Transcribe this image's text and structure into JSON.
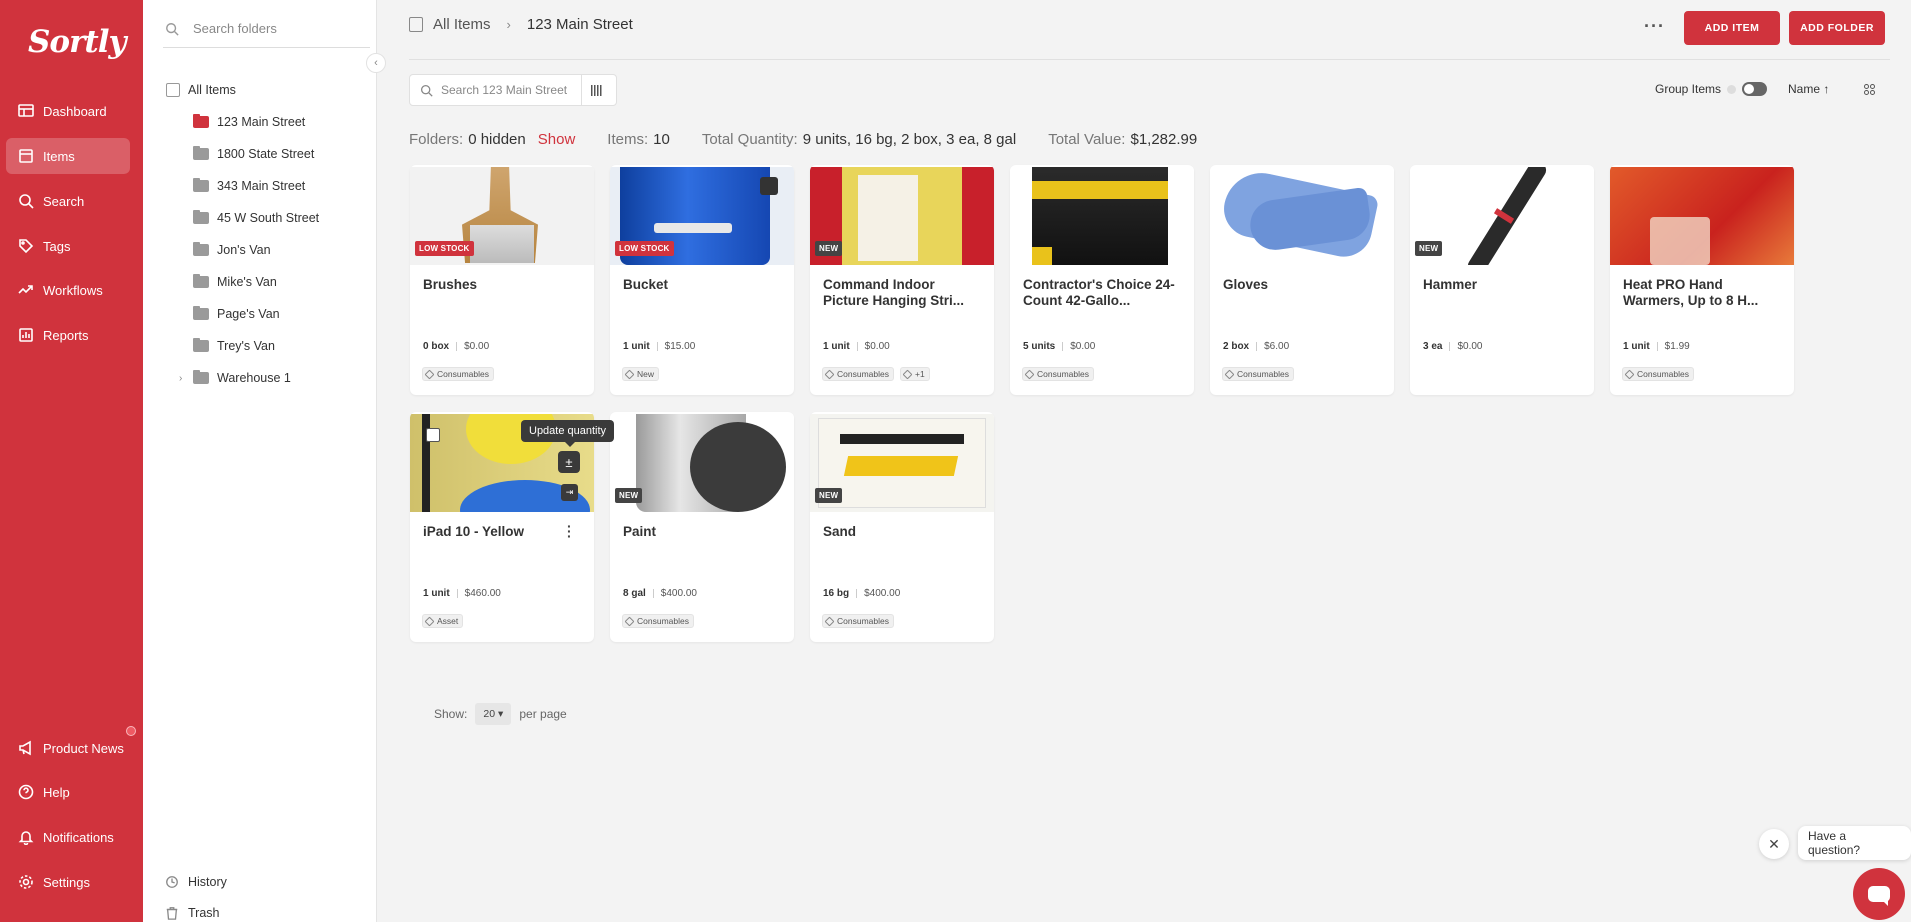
{
  "app": {
    "logo": "Sortly",
    "brand_color": "#d0333d"
  },
  "nav": {
    "items": [
      {
        "label": "Dashboard",
        "icon": "dashboard-icon"
      },
      {
        "label": "Items",
        "icon": "items-icon",
        "active": true
      },
      {
        "label": "Search",
        "icon": "search-icon"
      },
      {
        "label": "Tags",
        "icon": "tag-icon"
      },
      {
        "label": "Workflows",
        "icon": "workflow-icon"
      },
      {
        "label": "Reports",
        "icon": "reports-icon"
      }
    ],
    "bottom": [
      {
        "label": "Product News",
        "icon": "megaphone-icon"
      },
      {
        "label": "Help",
        "icon": "help-icon"
      },
      {
        "label": "Notifications",
        "icon": "bell-icon"
      },
      {
        "label": "Settings",
        "icon": "gear-icon"
      }
    ]
  },
  "folders": {
    "search_placeholder": "Search folders",
    "all_items": "All Items",
    "list": [
      "123 Main Street",
      "1800 State Street",
      "343 Main Street",
      "45 W South Street",
      "Jon's Van",
      "Mike's Van",
      "Page's Van",
      "Trey's Van",
      "Warehouse 1"
    ],
    "history": "History",
    "trash": "Trash"
  },
  "header": {
    "crumb_root": "All Items",
    "crumb_current": "123 Main Street",
    "add_item": "ADD ITEM",
    "add_folder": "ADD FOLDER"
  },
  "toolbar": {
    "search_placeholder": "Search 123 Main Street",
    "group_items": "Group Items",
    "sort_label": "Name"
  },
  "summary": {
    "folders_label": "Folders:",
    "folders_value": "0 hidden",
    "show": "Show",
    "items_label": "Items:",
    "items_value": "10",
    "qty_label": "Total Quantity:",
    "qty_value": "9 units, 16 bg, 2 box, 3 ea, 8 gal",
    "value_label": "Total Value:",
    "value_value": "$1,282.99"
  },
  "cards": [
    {
      "name": "Brushes",
      "chip": "LOW STOCK",
      "qty": "0 box",
      "price": "$0.00",
      "tags": [
        "Consumables"
      ]
    },
    {
      "name": "Bucket",
      "chip": "LOW STOCK",
      "qty": "1 unit",
      "price": "$15.00",
      "tags": [
        "New"
      ]
    },
    {
      "name": "Command Indoor Picture Hanging Stri...",
      "chip": "NEW",
      "qty": "1 unit",
      "price": "$0.00",
      "tags": [
        "Consumables",
        "+1"
      ]
    },
    {
      "name": "Contractor's Choice 24-Count 42-Gallo...",
      "chip": "",
      "qty": "5 units",
      "price": "$0.00",
      "tags": [
        "Consumables"
      ]
    },
    {
      "name": "Gloves",
      "chip": "",
      "qty": "2 box",
      "price": "$6.00",
      "tags": [
        "Consumables"
      ]
    },
    {
      "name": "Hammer",
      "chip": "NEW",
      "qty": "3 ea",
      "price": "$0.00",
      "tags": []
    },
    {
      "name": "Heat PRO Hand Warmers, Up to 8 H...",
      "chip": "",
      "qty": "1 unit",
      "price": "$1.99",
      "tags": [
        "Consumables"
      ]
    },
    {
      "name": "iPad 10 - Yellow",
      "chip": "",
      "qty": "1 unit",
      "price": "$460.00",
      "tags": [
        "Asset"
      ]
    },
    {
      "name": "Paint",
      "chip": "NEW",
      "qty": "8 gal",
      "price": "$400.00",
      "tags": [
        "Consumables"
      ]
    },
    {
      "name": "Sand",
      "chip": "NEW",
      "qty": "16 bg",
      "price": "$400.00",
      "tags": [
        "Consumables"
      ]
    }
  ],
  "tooltip": "Update quantity",
  "pagination": {
    "show": "Show:",
    "per_page_value": "20",
    "per_page": "per page"
  },
  "chat": {
    "question": "Have a question?"
  }
}
